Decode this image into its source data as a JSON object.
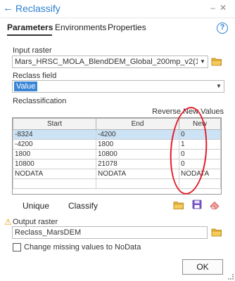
{
  "window": {
    "title": "Reclassify"
  },
  "tabs": [
    {
      "label": "Parameters",
      "active": true
    },
    {
      "label": "Environments",
      "active": false
    },
    {
      "label": "Properties",
      "active": false
    }
  ],
  "help_label": "?",
  "input_raster": {
    "label": "Input raster",
    "value": "Mars_HRSC_MOLA_BlendDEM_Global_200mp_v2(1).tif:1"
  },
  "reclass_field": {
    "label": "Reclass field",
    "value": "Value"
  },
  "reclassification": {
    "label": "Reclassification",
    "reverse_label": "Reverse New Values",
    "columns": [
      "Start",
      "End",
      "New"
    ],
    "rows": [
      [
        "-8324",
        "-4200",
        "0"
      ],
      [
        "-4200",
        "1800",
        "1"
      ],
      [
        "1800",
        "10800",
        "0"
      ],
      [
        "10800",
        "21078",
        "0"
      ],
      [
        "NODATA",
        "NODATA",
        "NODATA"
      ],
      [
        "",
        "",
        ""
      ]
    ],
    "selected_row": 0,
    "unique_label": "Unique",
    "classify_label": "Classify"
  },
  "output_raster": {
    "label": "Output raster",
    "value": "Reclass_MarsDEM"
  },
  "missing_values": {
    "label": "Change missing values to NoData",
    "checked": false
  },
  "ok_label": "OK",
  "colors": {
    "accent": "#2d7fd1",
    "selected_value_bg": "#3a86d6",
    "annotation_red": "#e41d2b",
    "warning": "#e69a00"
  }
}
